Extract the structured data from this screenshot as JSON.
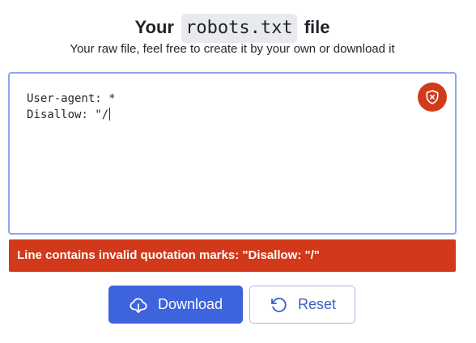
{
  "header": {
    "title_prefix": "Your",
    "title_code": "robots.txt",
    "title_suffix": "file",
    "subtitle": "Your raw file, feel free to create it by your own or download it"
  },
  "editor": {
    "content": "User-agent: *\nDisallow: \"/",
    "status_icon": "shield-x-icon",
    "status_color": "#d13b1a",
    "border_color": "#8ea6ee"
  },
  "error": {
    "message": "Line contains invalid quotation marks: \"Disallow: \"/\"",
    "color": "#d1391a"
  },
  "actions": {
    "download_label": "Download",
    "download_icon": "cloud-download-icon",
    "reset_label": "Reset",
    "reset_icon": "rotate-ccw-icon",
    "primary_color": "#3d63dd"
  }
}
